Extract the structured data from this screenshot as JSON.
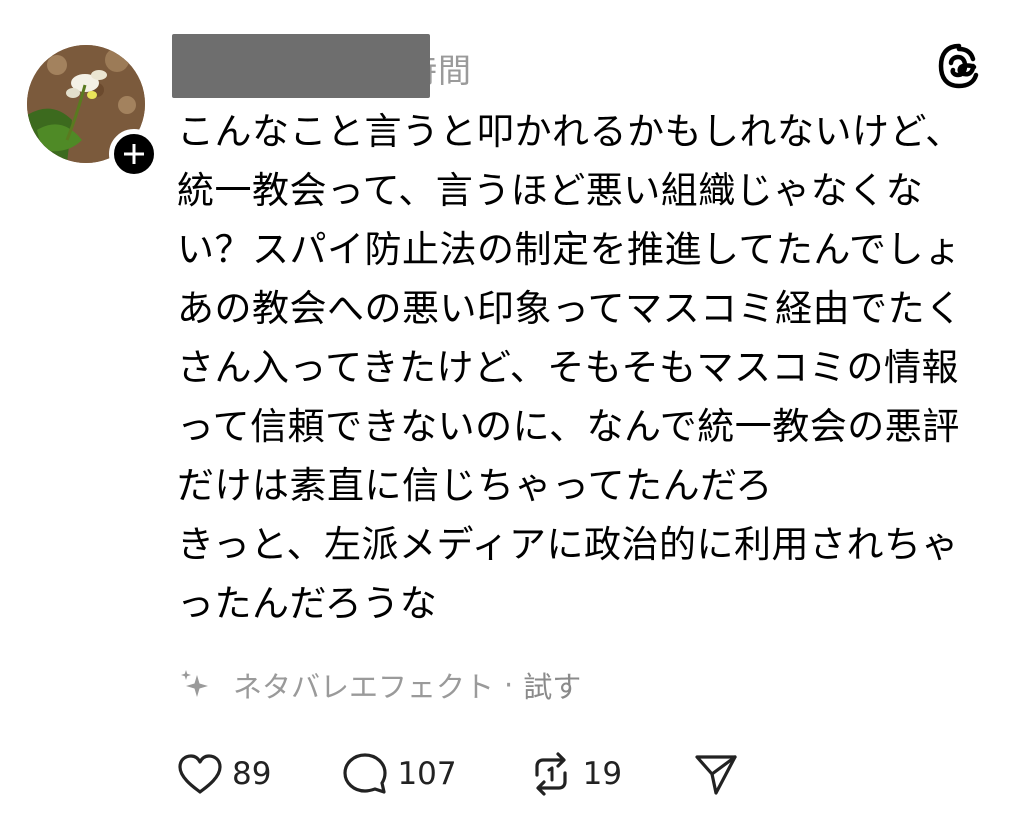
{
  "post": {
    "username": "",
    "timestamp": "時間",
    "lines": [
      "こんなこと言うと叩かれるかもしれないけど、",
      "統一教会って、言うほど悪い組織じゃなくな",
      "い？スパイ防止法の制定を推進してたんでしょ",
      "あの教会への悪い印象ってマスコミ経由でたく",
      "さん入ってきたけど、そもそもマスコミの情報",
      "って信頼できないのに、なんで統一教会の悪評",
      "だけは素直に信じちゃってたんだろ",
      "きっと、左派メディアに政治的に利用されちゃ",
      "ったんだろうな"
    ]
  },
  "ai_feature": {
    "icon": "sparkle-icon",
    "label": "ネタバレエフェクト",
    "separator": "·",
    "try_label": "試す"
  },
  "actions": {
    "like_count": "89",
    "reply_count": "107",
    "repost_count": "19",
    "icons": [
      "heart-icon",
      "comment-icon",
      "repost-icon",
      "send-icon"
    ]
  },
  "colors": {
    "muted_text": "#9a9a9a",
    "redaction": "#6e6e6e",
    "badge": "#000000"
  }
}
